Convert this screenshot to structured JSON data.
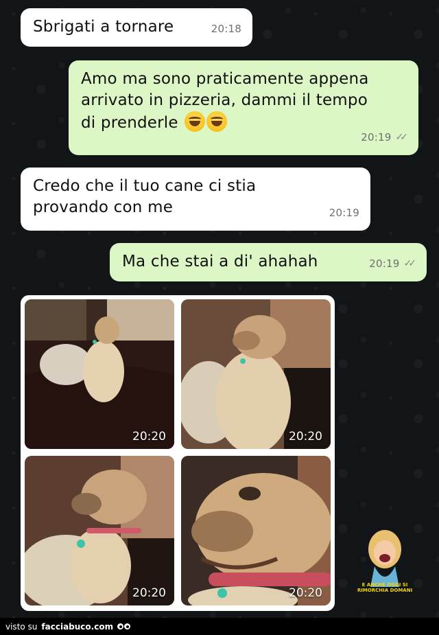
{
  "messages": [
    {
      "text": "Sbrigati a tornare",
      "time": "20:18"
    },
    {
      "text": "Amo ma sono praticamente appena\narrivato in pizzeria, dammi il tempo\ndi prenderle",
      "time": "20:19",
      "emojis": [
        "grinning-sweat-emoji",
        "tears-of-joy-emoji"
      ]
    },
    {
      "text": "Credo che il tuo cane ci stia\nprovando con me",
      "time": "20:19"
    },
    {
      "text": "Ma che stai a di' ahahah",
      "time": "20:19"
    }
  ],
  "ticks": "✓✓",
  "photos": [
    {
      "time": "20:20"
    },
    {
      "time": "20:20"
    },
    {
      "time": "20:20"
    },
    {
      "time": "20:20"
    }
  ],
  "sticker": {
    "caption": "E ANCHE OGGI SI RIMORCHIA DOMANI"
  },
  "footer": {
    "prefix": "visto su",
    "brand": "facciabuco.com"
  },
  "colors": {
    "incoming": "#ffffff",
    "outgoing": "#dcf7c5",
    "background": "#111518"
  }
}
